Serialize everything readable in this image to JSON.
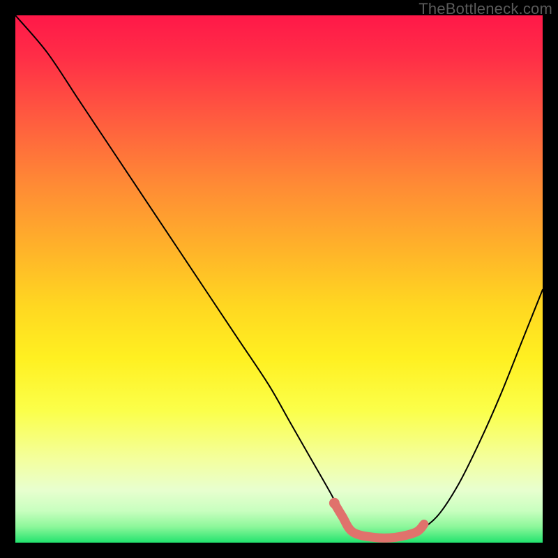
{
  "watermark": "TheBottleneck.com",
  "chart_data": {
    "type": "line",
    "title": "",
    "xlabel": "",
    "ylabel": "",
    "xlim": [
      0,
      100
    ],
    "ylim": [
      0,
      100
    ],
    "series": [
      {
        "name": "bottleneck-curve",
        "x": [
          0,
          6,
          12,
          18,
          24,
          30,
          36,
          42,
          48,
          52,
          56,
          60,
          62,
          64,
          68,
          72,
          76,
          80,
          84,
          88,
          92,
          96,
          100
        ],
        "y": [
          100,
          93,
          84,
          75,
          66,
          57,
          48,
          39,
          30,
          23,
          16,
          9,
          5,
          2,
          1,
          1,
          2,
          5,
          11,
          19,
          28,
          38,
          48
        ]
      }
    ],
    "highlight_segment": {
      "name": "optimal-zone",
      "x": [
        60.5,
        62,
        64,
        68,
        72,
        76,
        77.5
      ],
      "y": [
        7.5,
        5,
        2,
        1,
        1,
        2,
        3.5
      ]
    },
    "highlight_point": {
      "x": 60.5,
      "y": 7.5
    },
    "fit_color": "#e0726c",
    "curve_color": "#000000"
  }
}
